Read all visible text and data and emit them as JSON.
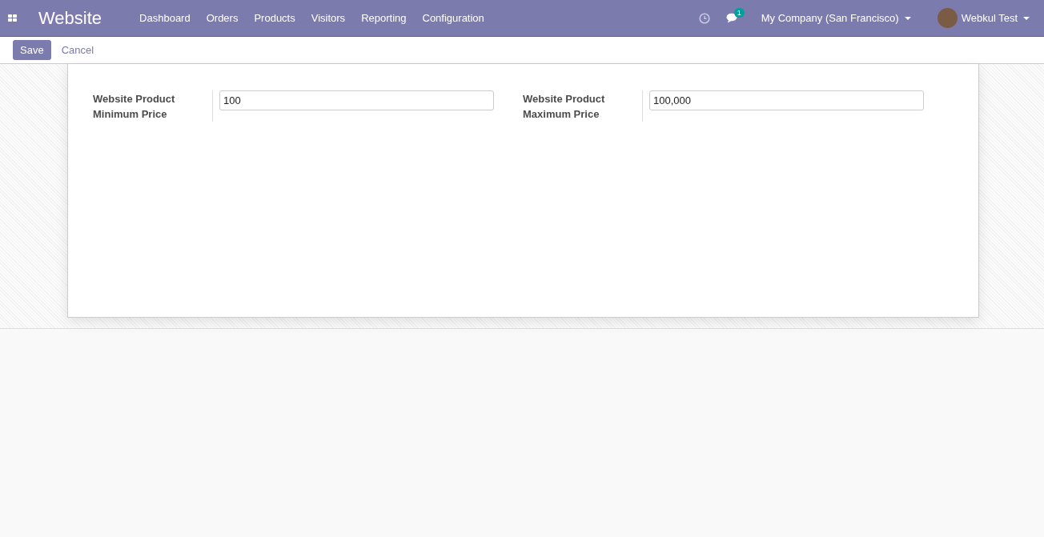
{
  "navbar": {
    "app_title": "Website",
    "menu": [
      "Dashboard",
      "Orders",
      "Products",
      "Visitors",
      "Reporting",
      "Configuration"
    ],
    "messages_badge": "1",
    "company": "My Company (San Francisco)",
    "user": "Webkul Test"
  },
  "control_panel": {
    "buttons": [
      {
        "label": "Save",
        "kind": "primary"
      },
      {
        "label": "Cancel",
        "kind": "link"
      }
    ]
  },
  "form": {
    "fields": [
      {
        "label": "Website Product Minimum Price",
        "value": "100"
      },
      {
        "label": "Website Product Maximum Price",
        "value": "100,000"
      }
    ]
  }
}
